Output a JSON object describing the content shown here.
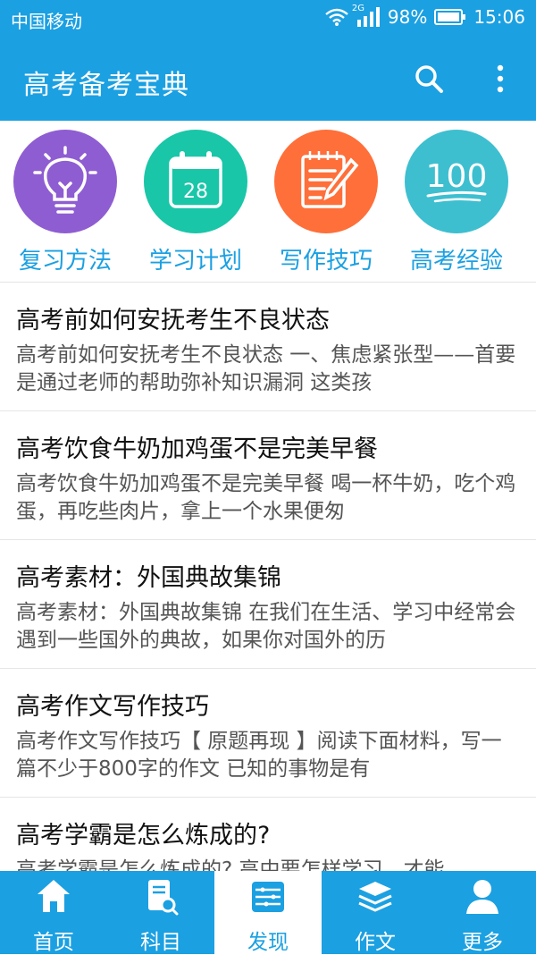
{
  "status_bar": {
    "carrier": "中国移动",
    "network": "2G",
    "battery": "98%",
    "time": "15:06"
  },
  "app_bar": {
    "title": "高考备考宝典",
    "search_icon": "search-icon",
    "more_icon": "more-vert-icon"
  },
  "categories": [
    {
      "label": "复习方法",
      "icon": "lightbulb-icon",
      "color": "#8f5dd2"
    },
    {
      "label": "学习计划",
      "icon": "calendar-icon",
      "color": "#19c6a8",
      "icon_text": "28"
    },
    {
      "label": "写作技巧",
      "icon": "writing-icon",
      "color": "#ff6f3a"
    },
    {
      "label": "高考经验",
      "icon": "score-100-icon",
      "color": "#3dbfd0",
      "icon_text": "100"
    }
  ],
  "articles": [
    {
      "title": "高考前如何安抚考生不良状态",
      "summary": "高考前如何安抚考生不良状态 一、焦虑紧张型——首要是通过老师的帮助弥补知识漏洞 这类孩"
    },
    {
      "title": "高考饮食牛奶加鸡蛋不是完美早餐",
      "summary": "高考饮食牛奶加鸡蛋不是完美早餐 喝一杯牛奶，吃个鸡蛋，再吃些肉片，拿上一个水果便匆"
    },
    {
      "title": "高考素材：外国典故集锦",
      "summary": "高考素材：外国典故集锦 在我们在生活、学习中经常会遇到一些国外的典故，如果你对国外的历"
    },
    {
      "title": "高考作文写作技巧",
      "summary": "高考作文写作技巧【 原题再现 】阅读下面材料，写一篇不少于800字的作文 已知的事物是有"
    },
    {
      "title": "高考学霸是怎么炼成的?",
      "summary": "高考学霸是怎么炼成的? 高中要怎样学习，才能"
    }
  ],
  "tabs": [
    {
      "label": "首页",
      "icon": "home-icon"
    },
    {
      "label": "科目",
      "icon": "book-search-icon"
    },
    {
      "label": "发现",
      "icon": "discover-icon",
      "active": true
    },
    {
      "label": "作文",
      "icon": "essay-stack-icon"
    },
    {
      "label": "更多",
      "icon": "person-icon"
    }
  ],
  "colors": {
    "primary": "#1ba0e2",
    "title_text": "#111111",
    "summary_text": "#555555"
  }
}
